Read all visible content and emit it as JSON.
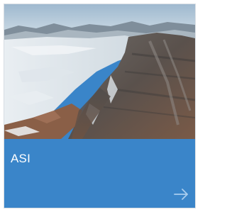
{
  "card": {
    "title": "ASI",
    "image_description_icon": "landscape-photo",
    "arrow_icon": "arrow-right-icon",
    "accent_color": "#3a85c9"
  }
}
